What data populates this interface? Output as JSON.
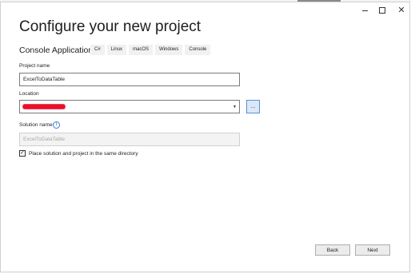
{
  "window": {
    "minimize_label": "Minimize",
    "maximize_label": "Maximize",
    "close_label": "Close"
  },
  "header": {
    "title": "Configure your new project",
    "template_name": "Console Application",
    "tags": [
      "C#",
      "Linux",
      "macOS",
      "Windows",
      "Console"
    ]
  },
  "form": {
    "project_name_label": "Project name",
    "project_name_value": "ExcelToDataTable",
    "location_label": "Location",
    "location_value": "",
    "browse_label": "...",
    "solution_name_label": "Solution name",
    "solution_name_value": "ExcelToDataTable",
    "same_directory_label": "Place solution and project in the same directory",
    "same_directory_checked": true
  },
  "footer": {
    "back_label": "Back",
    "next_label": "Next"
  },
  "icons": {
    "info": "info-icon",
    "dropdown": "chevron-down-icon",
    "checkmark": "checkmark-icon"
  },
  "colors": {
    "redaction": "#e8102a",
    "accent": "#3a7bd5",
    "browse_button_bg": "#dbe8f8"
  }
}
